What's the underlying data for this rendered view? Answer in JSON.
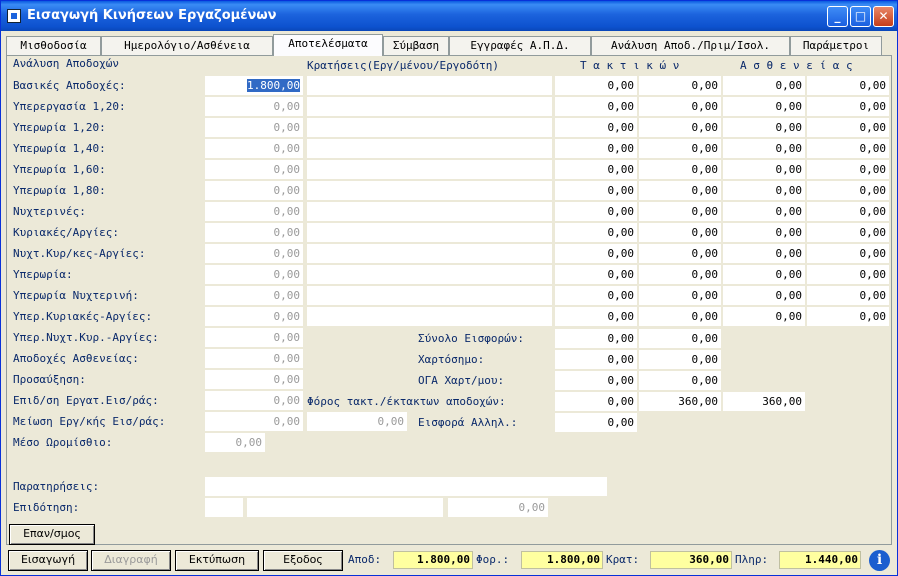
{
  "window": {
    "title": "Εισαγωγή Κινήσεων Εργαζομένων",
    "min": "_",
    "max": "□",
    "close": "✕"
  },
  "tabs": [
    "Μισθοδοσία",
    "Ημερολόγιο/Ασθένεια",
    "Αποτελέσματα",
    "Σύμβαση",
    "Εγγραφές Α.Π.Δ.",
    "Ανάλυση Αποδ./Πριμ/Ισολ.",
    "Παράμετροι"
  ],
  "headers": {
    "analysis": "Ανάλυση Αποδοχών",
    "deductions": "Κρατήσεις(Εργ/μένου/Εργοδότη)",
    "regular": "Τ α κ τ ι κ ώ ν",
    "sick": "Α σ θ ε ν ε ί α ς"
  },
  "rows": [
    {
      "label": "Βασικές Αποδοχές:",
      "value": "1.800,00",
      "c": [
        "0,00",
        "0,00",
        "0,00",
        "0,00"
      ]
    },
    {
      "label": "Υπερεργασία 1,20:",
      "value": "0,00",
      "c": [
        "0,00",
        "0,00",
        "0,00",
        "0,00"
      ]
    },
    {
      "label": "Υπερωρία 1,20:",
      "value": "0,00",
      "c": [
        "0,00",
        "0,00",
        "0,00",
        "0,00"
      ]
    },
    {
      "label": "Υπερωρία 1,40:",
      "value": "0,00",
      "c": [
        "0,00",
        "0,00",
        "0,00",
        "0,00"
      ]
    },
    {
      "label": "Υπερωρία 1,60:",
      "value": "0,00",
      "c": [
        "0,00",
        "0,00",
        "0,00",
        "0,00"
      ]
    },
    {
      "label": "Υπερωρία 1,80:",
      "value": "0,00",
      "c": [
        "0,00",
        "0,00",
        "0,00",
        "0,00"
      ]
    },
    {
      "label": "Νυχτερινές:",
      "value": "0,00",
      "c": [
        "0,00",
        "0,00",
        "0,00",
        "0,00"
      ]
    },
    {
      "label": "Κυριακές/Αργίες:",
      "value": "0,00",
      "c": [
        "0,00",
        "0,00",
        "0,00",
        "0,00"
      ]
    },
    {
      "label": "Νυχτ.Κυρ/κες-Αργίες:",
      "value": "0,00",
      "c": [
        "0,00",
        "0,00",
        "0,00",
        "0,00"
      ]
    },
    {
      "label": "Υπερωρία:",
      "value": "0,00",
      "c": [
        "0,00",
        "0,00",
        "0,00",
        "0,00"
      ]
    },
    {
      "label": "Υπερωρία Νυχτερινή:",
      "value": "0,00",
      "c": [
        "0,00",
        "0,00",
        "0,00",
        "0,00"
      ]
    },
    {
      "label": "Υπερ.Κυριακές-Αργίες:",
      "value": "0,00",
      "c": [
        "0,00",
        "0,00",
        "0,00",
        "0,00"
      ]
    },
    {
      "label": "Υπερ.Νυχτ.Κυρ.-Αργίες:",
      "value": "0,00"
    },
    {
      "label": "Αποδοχές Ασθενείας:",
      "value": "0,00"
    },
    {
      "label": "Προσαύξηση:",
      "value": "0,00"
    },
    {
      "label": "Επιδ/ση Εργατ.Εισ/ράς:",
      "value": "0,00"
    },
    {
      "label": "Μείωση Εργ/κής Εισ/ράς:",
      "value": "0,00",
      "extra": "0,00"
    },
    {
      "label": "Μέσο Ωρομίσθιο:",
      "value": "0,00"
    }
  ],
  "totals": {
    "contrib_label": "Σύνολο Εισφορών:",
    "contrib": [
      "0,00",
      "0,00"
    ],
    "stamp_label": "Χαρτόσημο:",
    "stamp": [
      "0,00",
      "0,00"
    ],
    "oga_label": "ΟΓΑ Χαρτ/μου:",
    "oga": [
      "0,00",
      "0,00"
    ],
    "tax_label": "Φόρος τακτ./έκτακτων αποδοχών:",
    "tax": [
      "0,00",
      "360,00",
      "360,00"
    ],
    "solidarity_label": "Εισφορά Αλληλ.:",
    "solidarity": "0,00"
  },
  "notes": {
    "remarks_label": "Παρατηρήσεις:",
    "subsidy_label": "Επιδότηση:",
    "subsidy_value": "0,00"
  },
  "buttons": {
    "recalc": "Επαν/σμος",
    "insert": "Εισαγωγή",
    "delete": "Διαγραφή",
    "print": "Εκτύπωση",
    "exit": "Εξοδος"
  },
  "summary": {
    "apod_label": "Αποδ:",
    "apod": "1.800,00",
    "for_label": "Φορ.:",
    "for": "1.800,00",
    "krat_label": "Κρατ:",
    "krat": "360,00",
    "plir_label": "Πληρ:",
    "plir": "1.440,00"
  },
  "colors": {
    "title_bar": "#1c63dd",
    "label_text": "#0b2a6b",
    "summary_field": "#ffffa0",
    "selection": "#316ac5"
  }
}
